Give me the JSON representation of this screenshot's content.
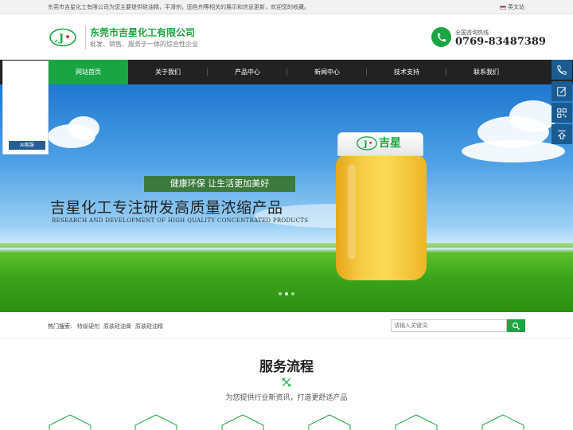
{
  "topbar": {
    "welcome": "东莞市吉星化工有限公司为您主要提供硅油精，平滑剂，固色剂等相关的展示和信息更新，欢迎您的收藏。",
    "language_link": "英文站"
  },
  "header": {
    "company_name": "东莞市吉星化工有限公司",
    "slogan": "批发、销售、服务于一体的综合性企业",
    "hotline_label": "全国咨询热线",
    "hotline_number": "0769-83487389",
    "logo_text": "J"
  },
  "nav": {
    "items": [
      {
        "label": "网站首页"
      },
      {
        "label": "关于我们"
      },
      {
        "label": "产品中心"
      },
      {
        "label": "新闻中心"
      },
      {
        "label": "技术支持"
      },
      {
        "label": "联系我们"
      }
    ]
  },
  "ai_panel": {
    "button_label": "AI客服"
  },
  "banner": {
    "tag": "健康环保  让生活更加美好",
    "title": "吉星化工专注研发高质量浓缩产品",
    "subtitle": "RESEARCH AND DEVELOPMENT OF HIGH QUALITY CONCENTRATED PRODUCTS",
    "jar_label": "吉星",
    "slide_count": 3,
    "active_slide": 2
  },
  "search": {
    "hot_label": "热门搜索:",
    "hot_items": [
      "特级硬剂",
      "原装硅油膏",
      "原装硅油精"
    ],
    "placeholder": "请输入关键词"
  },
  "service": {
    "title": "服务流程",
    "subtitle": "为您提供行业新资讯，打造更舒适产品"
  },
  "colors": {
    "brand_green": "#1aa542",
    "nav_dark": "#222222",
    "side_blue": "#1a5c91"
  },
  "icons": {
    "side_tools": [
      "phone-icon",
      "edit-icon",
      "qrcode-icon",
      "back-to-top-icon"
    ],
    "search": "search-icon",
    "hotline": "phone-icon"
  }
}
